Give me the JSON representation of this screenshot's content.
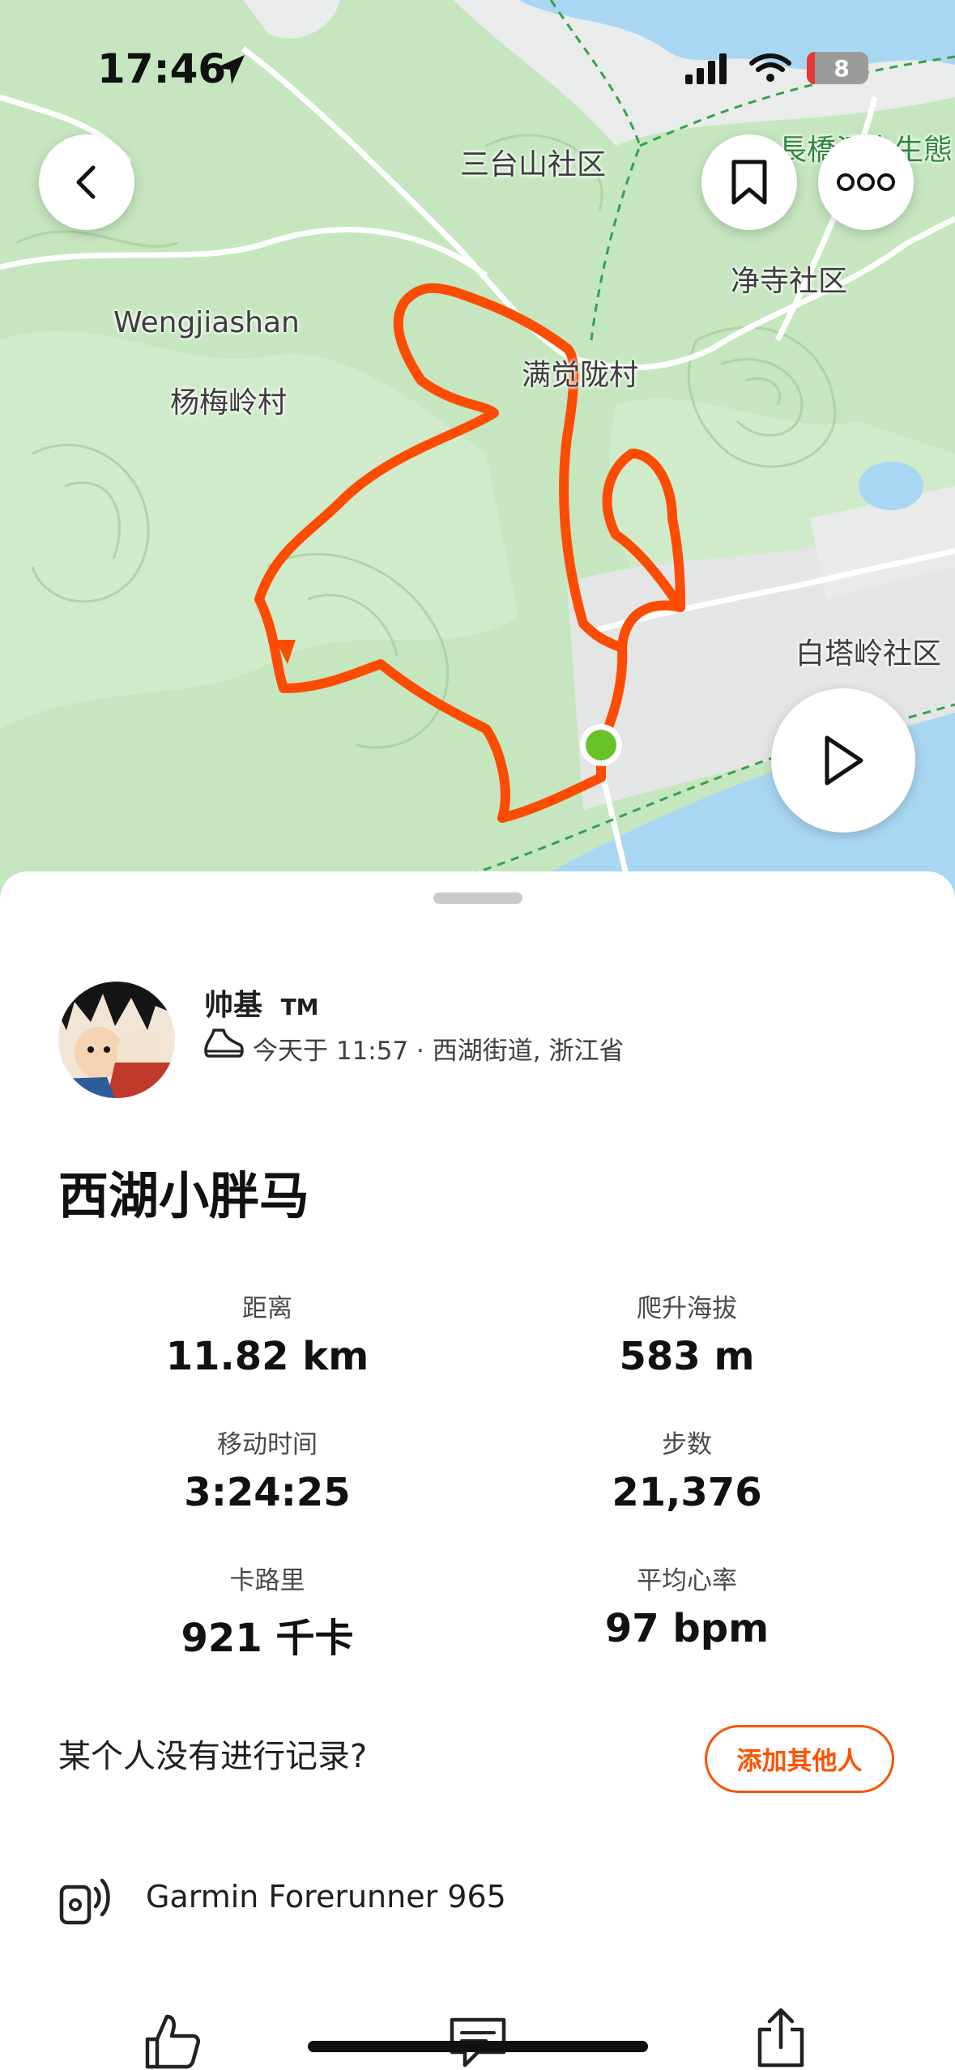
{
  "status_bar": {
    "time": "17:46",
    "battery": "8"
  },
  "map": {
    "labels": {
      "santaishan": "三台山社区",
      "changqiao": "長橋溪水生態",
      "jingsi": "净寺社区",
      "wengjiashan": "Wengjiashan",
      "yangmeiling": "杨梅岭村",
      "manjuelong": "满觉陇村",
      "baitaling": "白塔岭社区"
    },
    "colors": {
      "route": "#fc4c02",
      "start": "#6ac22b",
      "water": "#a9d6f2",
      "forest": "#bde3b6"
    }
  },
  "activity": {
    "athlete_name": "帅基",
    "athlete_badge": "TM",
    "meta": "今天于 11:57 · 西湖街道, 浙江省",
    "title": "西湖小胖马"
  },
  "stats": [
    {
      "label": "距离",
      "value": "11.82 km"
    },
    {
      "label": "爬升海拔",
      "value": "583 m"
    },
    {
      "label": "移动时间",
      "value": "3:24:25"
    },
    {
      "label": "步数",
      "value": "21,376"
    },
    {
      "label": "卡路里",
      "value": "921 千卡"
    },
    {
      "label": "平均心率",
      "value": "97 bpm"
    }
  ],
  "add_others": {
    "question": "某个人没有进行记录?",
    "button": "添加其他人"
  },
  "device": {
    "name": "Garmin Forerunner 965"
  },
  "colors": {
    "accent": "#fc5200"
  }
}
